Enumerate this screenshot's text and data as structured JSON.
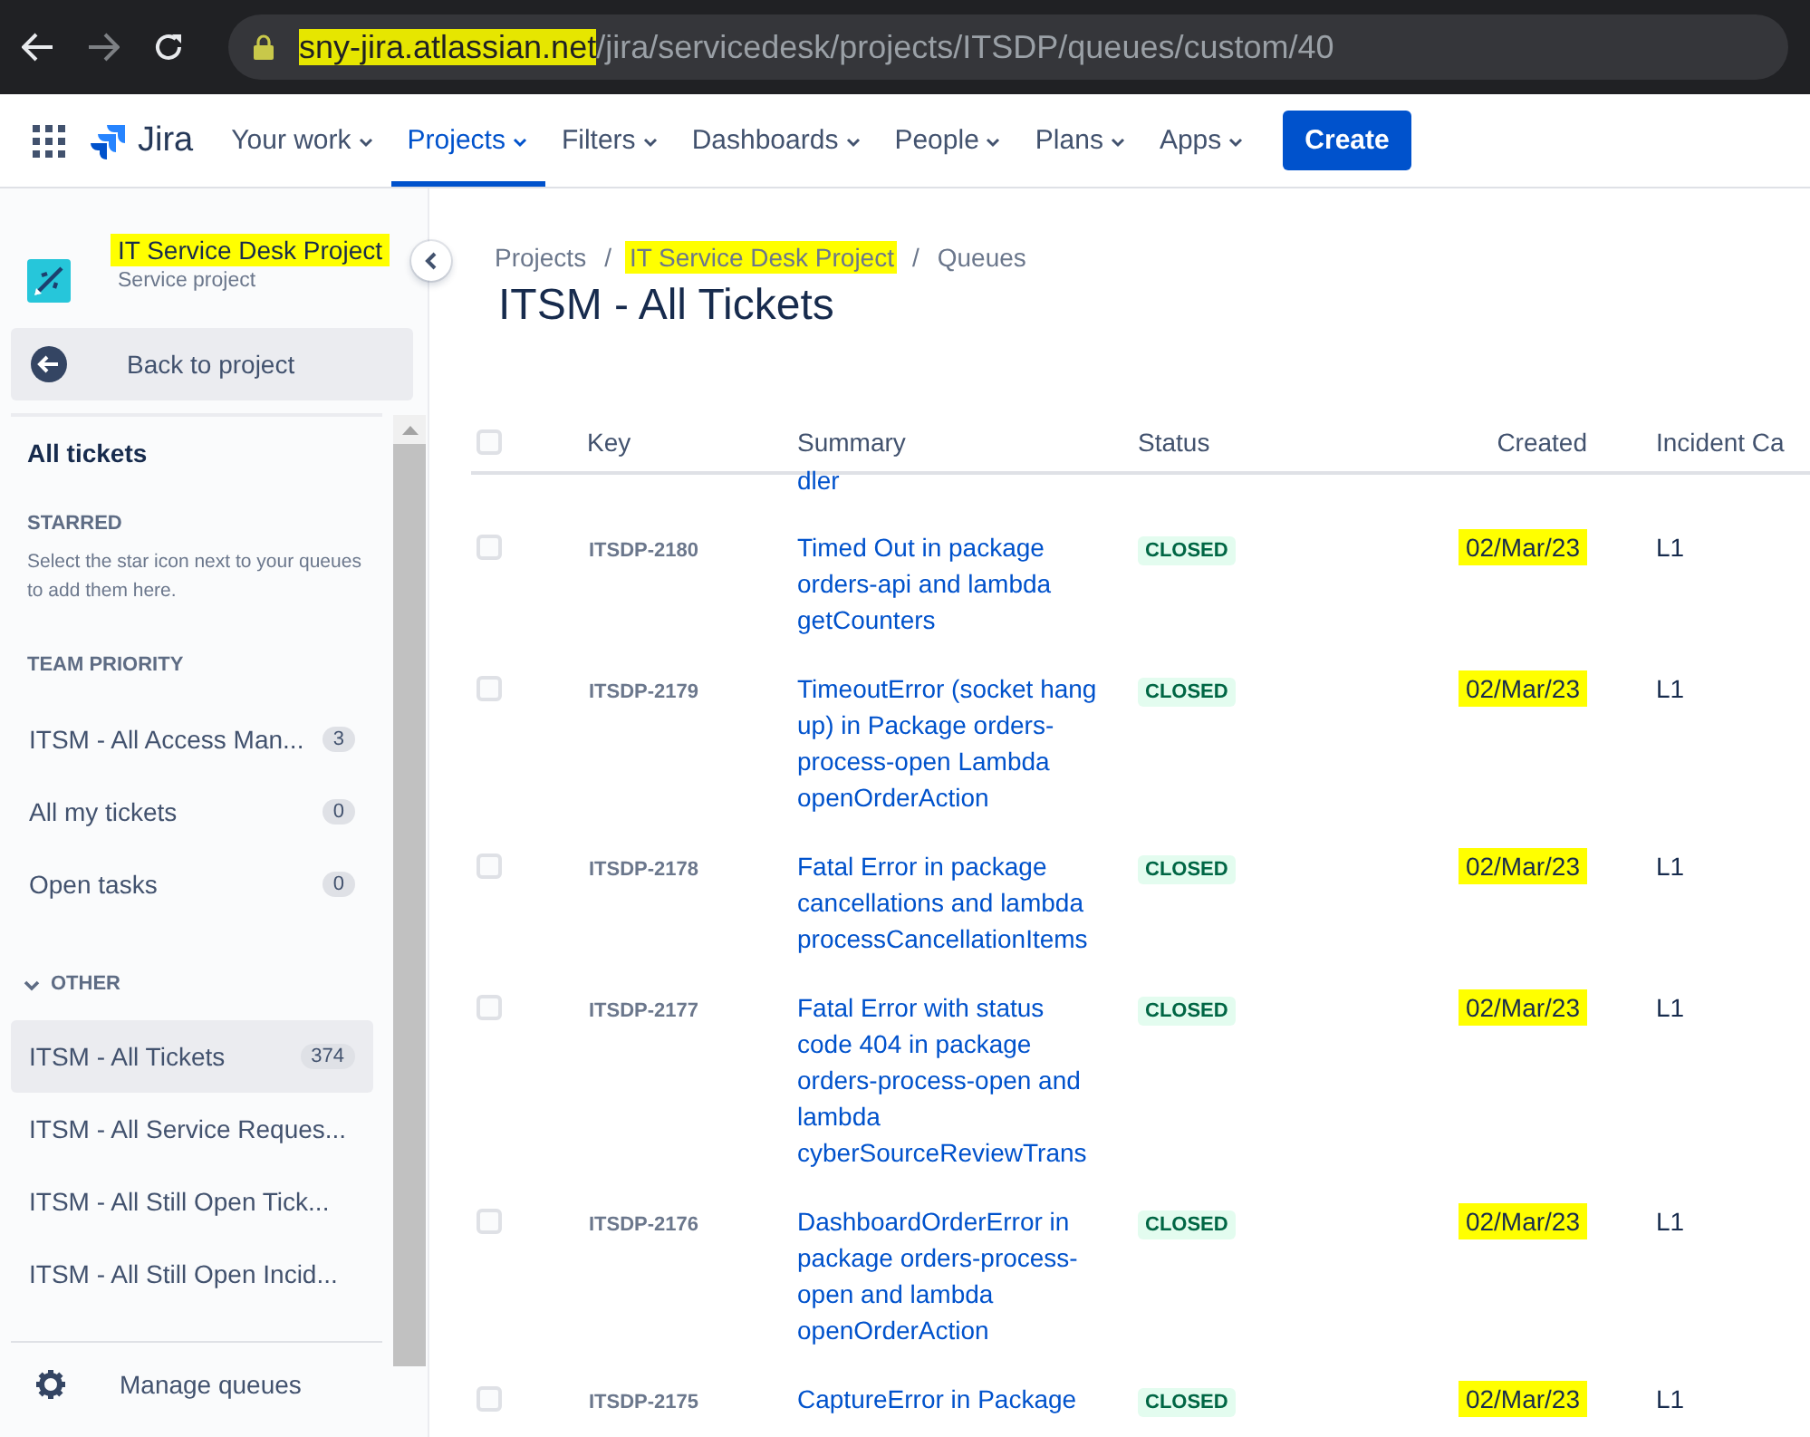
{
  "browser": {
    "url_host": "sny-jira.atlassian.net",
    "url_path": "/jira/servicedesk/projects/ITSDP/queues/custom/40",
    "host_highlighted": true
  },
  "nav": {
    "product": "Jira",
    "items": [
      {
        "label": "Your work",
        "selected": false
      },
      {
        "label": "Projects",
        "selected": true
      },
      {
        "label": "Filters",
        "selected": false
      },
      {
        "label": "Dashboards",
        "selected": false
      },
      {
        "label": "People",
        "selected": false
      },
      {
        "label": "Plans",
        "selected": false
      },
      {
        "label": "Apps",
        "selected": false
      }
    ],
    "create": "Create"
  },
  "sidebar": {
    "project": {
      "name": "IT Service Desk Project",
      "type": "Service project",
      "highlighted": true
    },
    "back": "Back to project",
    "all_tickets": "All tickets",
    "starred": {
      "title": "STARRED",
      "hint": "Select the star icon next to your queues to add them here."
    },
    "team_priority": {
      "title": "TEAM PRIORITY",
      "items": [
        {
          "label": "ITSM - All Access Man...",
          "count": "3",
          "selected": false
        },
        {
          "label": "All my tickets",
          "count": "0",
          "selected": false
        },
        {
          "label": "Open tasks",
          "count": "0",
          "selected": false
        }
      ]
    },
    "other": {
      "title": "OTHER",
      "expanded": true,
      "items": [
        {
          "label": "ITSM - All Tickets",
          "count": "374",
          "selected": true
        },
        {
          "label": "ITSM - All Service Reques...",
          "selected": false
        },
        {
          "label": "ITSM - All Still Open Tick...",
          "selected": false
        },
        {
          "label": "ITSM - All Still Open Incid...",
          "selected": false
        }
      ]
    },
    "manage": "Manage queues"
  },
  "breadcrumbs": [
    {
      "label": "Projects",
      "highlighted": false
    },
    {
      "separator": "/",
      "label": "IT Service Desk Project",
      "highlighted": true
    },
    {
      "separator": "/",
      "label": "Queues",
      "highlighted": false
    }
  ],
  "title": "ITSM - All Tickets",
  "table": {
    "header_checked": false,
    "columns": [
      "Key",
      "Summary",
      "Status",
      "Created",
      "Incident Ca"
    ],
    "rows": [
      {
        "kind": "fragment",
        "summary": "dler"
      },
      {
        "kind": "ticket",
        "checked": false,
        "key": "ITSDP-2180",
        "summary": "Timed Out in package orders-api and lambda getCounters",
        "status": "CLOSED",
        "created": "02/Mar/23",
        "created_highlighted": true,
        "incident_category": "L1"
      },
      {
        "kind": "ticket",
        "checked": false,
        "key": "ITSDP-2179",
        "summary": "TimeoutError (socket hang up) in Package orders-process-open Lambda openOrderAction",
        "status": "CLOSED",
        "created": "02/Mar/23",
        "created_highlighted": true,
        "incident_category": "L1"
      },
      {
        "kind": "ticket",
        "checked": false,
        "key": "ITSDP-2178",
        "summary": "Fatal Error in package cancellations and lambda processCancellationItems",
        "status": "CLOSED",
        "created": "02/Mar/23",
        "created_highlighted": true,
        "incident_category": "L1"
      },
      {
        "kind": "ticket",
        "checked": false,
        "key": "ITSDP-2177",
        "summary": "Fatal Error with status code 404 in package orders-process-open and lambda cyberSourceReviewTrans",
        "status": "CLOSED",
        "created": "02/Mar/23",
        "created_highlighted": true,
        "incident_category": "L1"
      },
      {
        "kind": "ticket",
        "checked": false,
        "key": "ITSDP-2176",
        "summary": "DashboardOrderError in package orders-process-open and lambda openOrderAction",
        "status": "CLOSED",
        "created": "02/Mar/23",
        "created_highlighted": true,
        "incident_category": "L1"
      },
      {
        "kind": "ticket",
        "checked": false,
        "key": "ITSDP-2175",
        "summary": "CaptureError in Package",
        "status": "CLOSED",
        "created": "02/Mar/23",
        "created_highlighted": true,
        "incident_category": "L1"
      }
    ]
  }
}
